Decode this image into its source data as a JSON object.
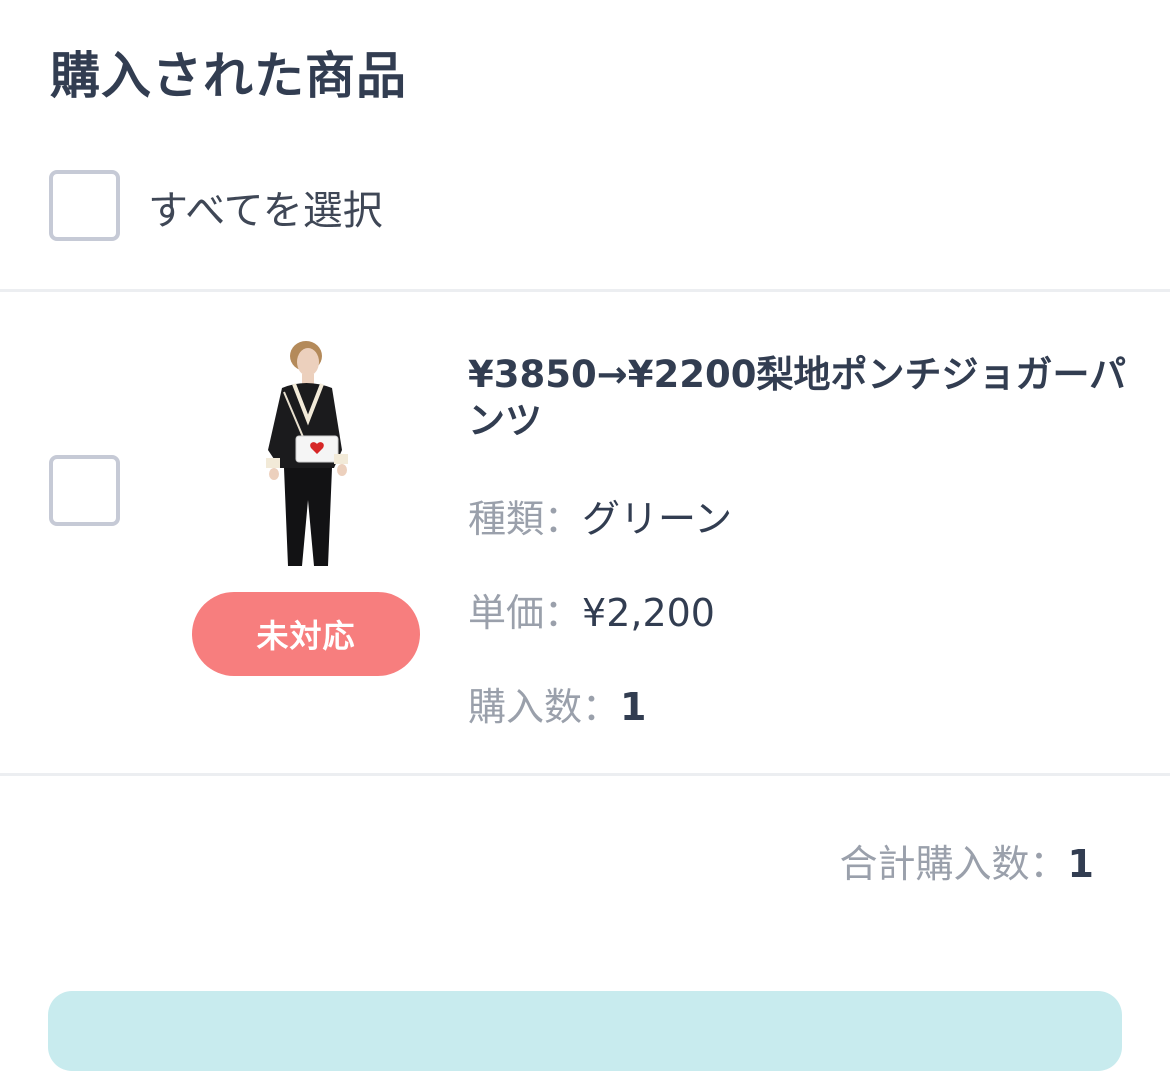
{
  "page": {
    "title": "購入された商品"
  },
  "select_all": {
    "label": "すべてを選択",
    "checked": false
  },
  "item": {
    "checked": false,
    "name": "¥3850→¥2200梨地ポンチジョガーパンツ",
    "status": "未対応",
    "variant_label": "種類：",
    "variant_value": "グリーン",
    "price_label": "単価：",
    "price_value": "¥2,200",
    "qty_label": "購入数：",
    "qty_value": "1"
  },
  "summary": {
    "total_label": "合計購入数：",
    "total_value": "1"
  },
  "colors": {
    "status_badge": "#f77e7e",
    "action_bar": "#c8ebee",
    "text_primary": "#323d51",
    "text_muted": "#9aa0ab",
    "checkbox_border": "#c6cad6"
  }
}
